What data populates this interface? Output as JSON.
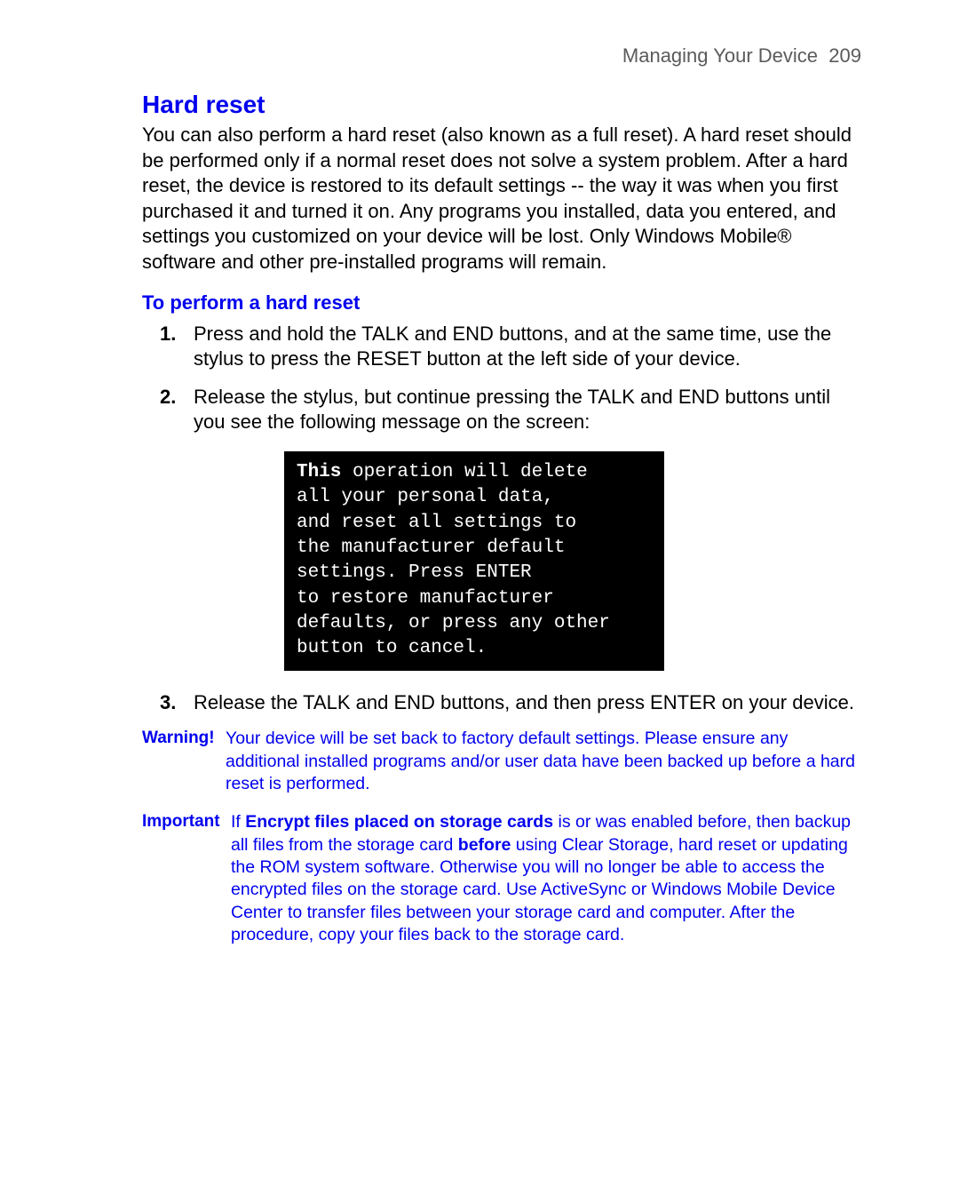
{
  "header": {
    "chapter": "Managing Your Device",
    "page_number": "209"
  },
  "section": {
    "title": "Hard reset",
    "intro": "You can also perform a hard reset (also known as a full reset). A hard reset should be performed only if a normal reset does not solve a system problem. After a hard reset, the device is restored to its default settings -- the way it was when you first purchased it and turned it on. Any programs you installed, data you entered, and settings you customized on your device will be lost. Only Windows Mobile® software and other pre-installed programs will remain."
  },
  "procedure": {
    "heading": "To perform a hard reset",
    "steps": [
      {
        "num": "1.",
        "text": "Press and hold the TALK and END buttons, and at the same time, use the stylus to press the RESET button at the left side of your device."
      },
      {
        "num": "2.",
        "text": "Release the stylus, but continue pressing the TALK and END buttons until you see the following message on the screen:"
      },
      {
        "num": "3.",
        "text": "Release the TALK and END buttons, and then press ENTER on your device."
      }
    ]
  },
  "console": {
    "bold_word": "This",
    "rest": " operation will delete\nall your personal data,\nand reset all settings to\nthe manufacturer default\nsettings. Press ENTER\nto restore manufacturer\ndefaults, or press any other\nbutton to cancel."
  },
  "warning": {
    "label": "Warning!",
    "text": "Your device will be set back to factory default settings. Please ensure any additional installed programs and/or user data have been backed up before a hard reset is performed."
  },
  "important": {
    "label": "Important",
    "pre": "If ",
    "bold1": "Encrypt files placed on storage cards",
    "mid1": " is or was enabled before, then backup all files from the storage card ",
    "bold2": "before",
    "post": " using Clear Storage, hard reset or updating the ROM system software. Otherwise you will no longer be able to access the encrypted files on the storage card. Use ActiveSync or Windows Mobile Device Center to transfer files between your storage card and computer. After the procedure, copy your files back to the storage card."
  }
}
